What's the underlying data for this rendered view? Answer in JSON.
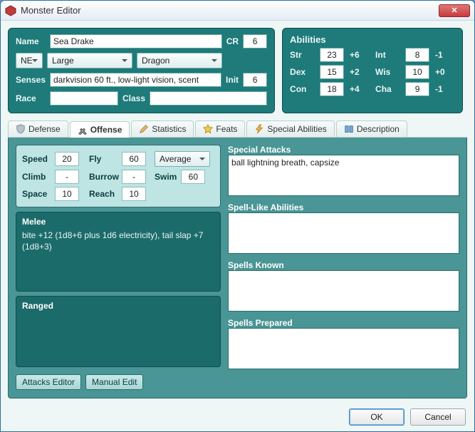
{
  "window": {
    "title": "Monster Editor"
  },
  "basics": {
    "nameLabel": "Name",
    "name": "Sea Drake",
    "crLabel": "CR",
    "cr": "6",
    "alignment": "NE",
    "size": "Large",
    "type": "Dragon",
    "sensesLabel": "Senses",
    "senses": "darkvision 60 ft., low-light vision, scent",
    "initLabel": "Init",
    "init": "6",
    "raceLabel": "Race",
    "race": "",
    "classLabel": "Class",
    "class": ""
  },
  "abilities": {
    "title": "Abilities",
    "str": {
      "label": "Str",
      "score": "23",
      "mod": "+6"
    },
    "dex": {
      "label": "Dex",
      "score": "15",
      "mod": "+2"
    },
    "con": {
      "label": "Con",
      "score": "18",
      "mod": "+4"
    },
    "int": {
      "label": "Int",
      "score": "8",
      "mod": "-1"
    },
    "wis": {
      "label": "Wis",
      "score": "10",
      "mod": "+0"
    },
    "cha": {
      "label": "Cha",
      "score": "9",
      "mod": "-1"
    }
  },
  "tabs": {
    "defense": "Defense",
    "offense": "Offense",
    "statistics": "Statistics",
    "feats": "Feats",
    "special": "Special Abilities",
    "description": "Description"
  },
  "offense": {
    "speed": {
      "speedLabel": "Speed",
      "speed": "20",
      "flyLabel": "Fly",
      "fly": "60",
      "maneuver": "Average",
      "climbLabel": "Climb",
      "climb": "-",
      "burrowLabel": "Burrow",
      "burrow": "-",
      "swimLabel": "Swim",
      "swim": "60",
      "spaceLabel": "Space",
      "space": "10",
      "reachLabel": "Reach",
      "reach": "10"
    },
    "melee": {
      "title": "Melee",
      "text": "bite +12 (1d8+6 plus 1d6 electricity),  tail slap +7 (1d8+3)"
    },
    "ranged": {
      "title": "Ranged",
      "text": ""
    },
    "specialAttacks": {
      "title": "Special Attacks",
      "text": "ball lightning breath, capsize"
    },
    "sla": {
      "title": "Spell-Like Abilities",
      "text": ""
    },
    "spellsKnown": {
      "title": "Spells Known",
      "text": ""
    },
    "spellsPrepared": {
      "title": "Spells Prepared",
      "text": ""
    },
    "attacksEditor": "Attacks Editor",
    "manualEdit": "Manual Edit"
  },
  "buttons": {
    "ok": "OK",
    "cancel": "Cancel"
  }
}
